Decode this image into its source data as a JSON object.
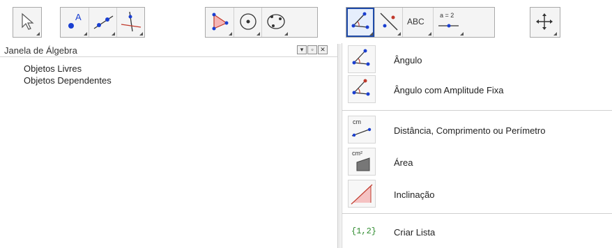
{
  "toolbar": {
    "groups": [
      {
        "tools": [
          "move-tool"
        ]
      },
      {
        "tools": [
          "point-tool",
          "line-tool",
          "perpendicular-line-tool"
        ]
      },
      {
        "tools": [
          "polygon-tool",
          "circle-tool",
          "conic-tool"
        ]
      },
      {
        "tools": [
          "angle-tool",
          "reflect-tool",
          "text-tool",
          "slider-tool"
        ]
      },
      {
        "tools": [
          "move-graphics-view-tool"
        ]
      }
    ],
    "text_tool_label": "ABC",
    "slider_tool_label": "a = 2"
  },
  "algebra_panel": {
    "title": "Janela de Álgebra",
    "items": [
      "Objetos Livres",
      "Objetos Dependentes"
    ]
  },
  "menu": {
    "items": [
      {
        "label": "Ângulo",
        "icon": "angle-icon"
      },
      {
        "label": "Ângulo com Amplitude Fixa",
        "icon": "angle-fixed-icon"
      },
      {
        "label": "Distância, Comprimento ou Perímetro",
        "icon": "distance-icon",
        "icon_text": "cm"
      },
      {
        "label": "Área",
        "icon": "area-icon",
        "icon_text": "cm²"
      },
      {
        "label": "Inclinação",
        "icon": "slope-icon"
      },
      {
        "label": "Criar Lista",
        "icon": "list-icon",
        "icon_text": "{1,2}"
      }
    ]
  },
  "colors": {
    "accent": "#1e4aa8",
    "point_blue": "#1a3fd1",
    "point_red": "#c0392b",
    "list_green": "#2e8b2e"
  }
}
